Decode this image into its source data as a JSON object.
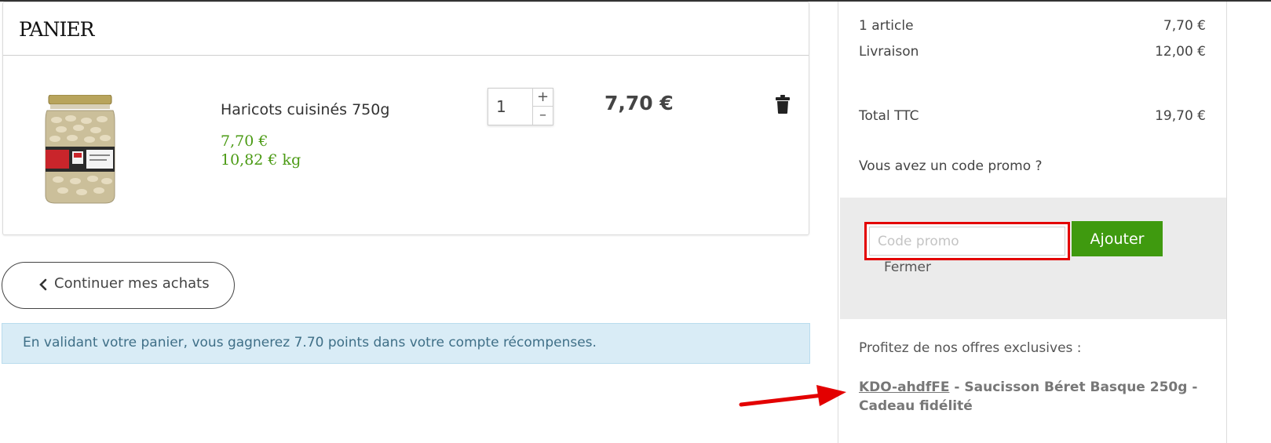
{
  "cart": {
    "title": "PANIER",
    "item": {
      "name": "Haricots cuisinés 750g",
      "price": "7,70  €",
      "unit_price": "10,82  € kg",
      "quantity": "1",
      "plus": "+",
      "minus": "–",
      "line_total": "7,70 €"
    }
  },
  "continue_label": "Continuer mes achats",
  "info_banner": "En validant votre panier, vous gagnerez 7.70 points dans votre compte récompenses.",
  "summary": {
    "items_label": "1 article",
    "items_value": "7,70 €",
    "shipping_label": "Livraison",
    "shipping_value": "12,00 €",
    "total_label": "Total TTC",
    "total_value": "19,70 €",
    "promo_question": "Vous avez un code promo ?",
    "promo_placeholder": "Code promo",
    "add_button": "Ajouter",
    "close_label": "Fermer",
    "offers_title": "Profitez de nos offres exclusives :",
    "offer": {
      "code": "KDO-ahdfFE",
      "description_1": " - Saucisson Béret Basque 250g -",
      "description_2": "Cadeau fidélité"
    }
  },
  "colors": {
    "accent_green": "#3f9a0f",
    "price_green": "#4a9a13",
    "highlight_red": "#e30000",
    "banner_blue": "#d9ecf6"
  },
  "icons": {
    "trash": "trash-icon",
    "chevron": "chevron-left-icon",
    "arrow": "red-arrow-annotation"
  }
}
